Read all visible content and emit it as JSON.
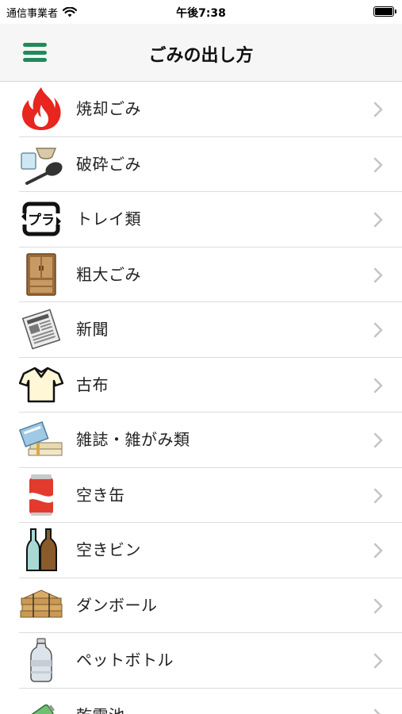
{
  "status_bar": {
    "carrier": "通信事業者",
    "time": "午後7:38"
  },
  "nav": {
    "title": "ごみの出し方",
    "menu_icon": "hamburger-menu-icon"
  },
  "colors": {
    "accent": "#1f8a5a",
    "chevron": "#c4c4c9",
    "separator": "#dcdcdc"
  },
  "items": [
    {
      "label": "焼却ごみ",
      "icon": "fire-icon"
    },
    {
      "label": "破砕ごみ",
      "icon": "broken-dishes-icon"
    },
    {
      "label": "トレイ類",
      "icon": "plastic-recycle-icon"
    },
    {
      "label": "粗大ごみ",
      "icon": "cabinet-icon"
    },
    {
      "label": "新聞",
      "icon": "newspaper-icon"
    },
    {
      "label": "古布",
      "icon": "shirt-icon"
    },
    {
      "label": "雑誌・雑がみ類",
      "icon": "magazines-icon"
    },
    {
      "label": "空き缶",
      "icon": "can-icon"
    },
    {
      "label": "空きビン",
      "icon": "bottles-icon"
    },
    {
      "label": "ダンボール",
      "icon": "cardboard-icon"
    },
    {
      "label": "ペットボトル",
      "icon": "pet-bottle-icon"
    },
    {
      "label": "乾電池",
      "icon": "battery-icon"
    }
  ]
}
